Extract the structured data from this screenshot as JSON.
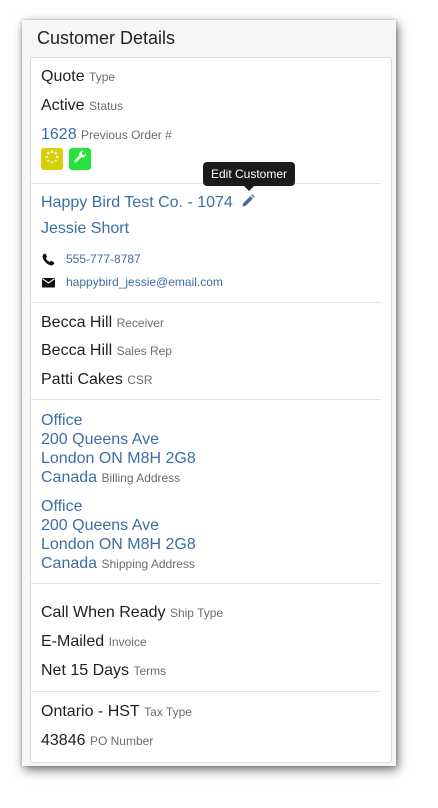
{
  "panel": {
    "title": "Customer Details"
  },
  "order": {
    "quote_value": "Quote",
    "quote_label": "Type",
    "status_value": "Active",
    "status_label": "Status",
    "previous_order_value": "1628",
    "previous_order_label": "Previous Order #"
  },
  "badges": [
    {
      "icon": "spinner-icon",
      "color": "#d8cf0a"
    },
    {
      "icon": "wrench-icon",
      "color": "#26e23a"
    }
  ],
  "customer": {
    "company": "Happy Bird Test Co. - 1074",
    "contact_name": "Jessie Short",
    "phone": "555-777-8787",
    "email": "happybird_jessie@email.com",
    "edit_tooltip": "Edit Customer"
  },
  "people": {
    "receiver_value": "Becca Hill",
    "receiver_label": "Receiver",
    "sales_rep_value": "Becca Hill",
    "sales_rep_label": "Sales Rep",
    "csr_value": "Patti Cakes",
    "csr_label": "CSR"
  },
  "billing": {
    "line1": "Office",
    "line2": "200 Queens Ave",
    "line3": "London ON M8H 2G8",
    "country": "Canada",
    "label": "Billing Address"
  },
  "shipping": {
    "line1": "Office",
    "line2": "200 Queens Ave",
    "line3": "London ON M8H 2G8",
    "country": "Canada",
    "label": "Shipping Address"
  },
  "terms": {
    "ship_value": "Call When Ready",
    "ship_label": "Ship Type",
    "invoice_value": "E-Mailed",
    "invoice_label": "Invoice",
    "terms_value": "Net 15 Days",
    "terms_label": "Terms"
  },
  "tax": {
    "tax_value": "Ontario - HST",
    "tax_label": "Tax Type",
    "po_value": "43846",
    "po_label": "PO Number"
  }
}
